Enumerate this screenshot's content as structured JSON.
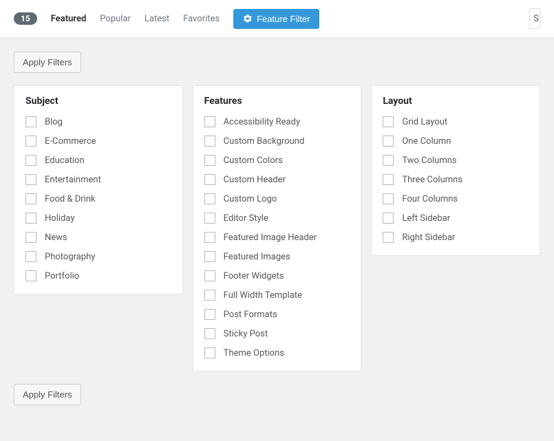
{
  "topbar": {
    "count": "15",
    "tabs": [
      {
        "label": "Featured",
        "active": true
      },
      {
        "label": "Popular",
        "active": false
      },
      {
        "label": "Latest",
        "active": false
      },
      {
        "label": "Favorites",
        "active": false
      }
    ],
    "feature_filter_label": "Feature Filter",
    "search_stub": "S"
  },
  "apply_filters_label": "Apply Filters",
  "columns": [
    {
      "title": "Subject",
      "items": [
        "Blog",
        "E-Commerce",
        "Education",
        "Entertainment",
        "Food & Drink",
        "Holiday",
        "News",
        "Photography",
        "Portfolio"
      ]
    },
    {
      "title": "Features",
      "items": [
        "Accessibility Ready",
        "Custom Background",
        "Custom Colors",
        "Custom Header",
        "Custom Logo",
        "Editor Style",
        "Featured Image Header",
        "Featured Images",
        "Footer Widgets",
        "Full Width Template",
        "Post Formats",
        "Sticky Post",
        "Theme Options"
      ]
    },
    {
      "title": "Layout",
      "items": [
        "Grid Layout",
        "One Column",
        "Two Columns",
        "Three Columns",
        "Four Columns",
        "Left Sidebar",
        "Right Sidebar"
      ]
    }
  ]
}
